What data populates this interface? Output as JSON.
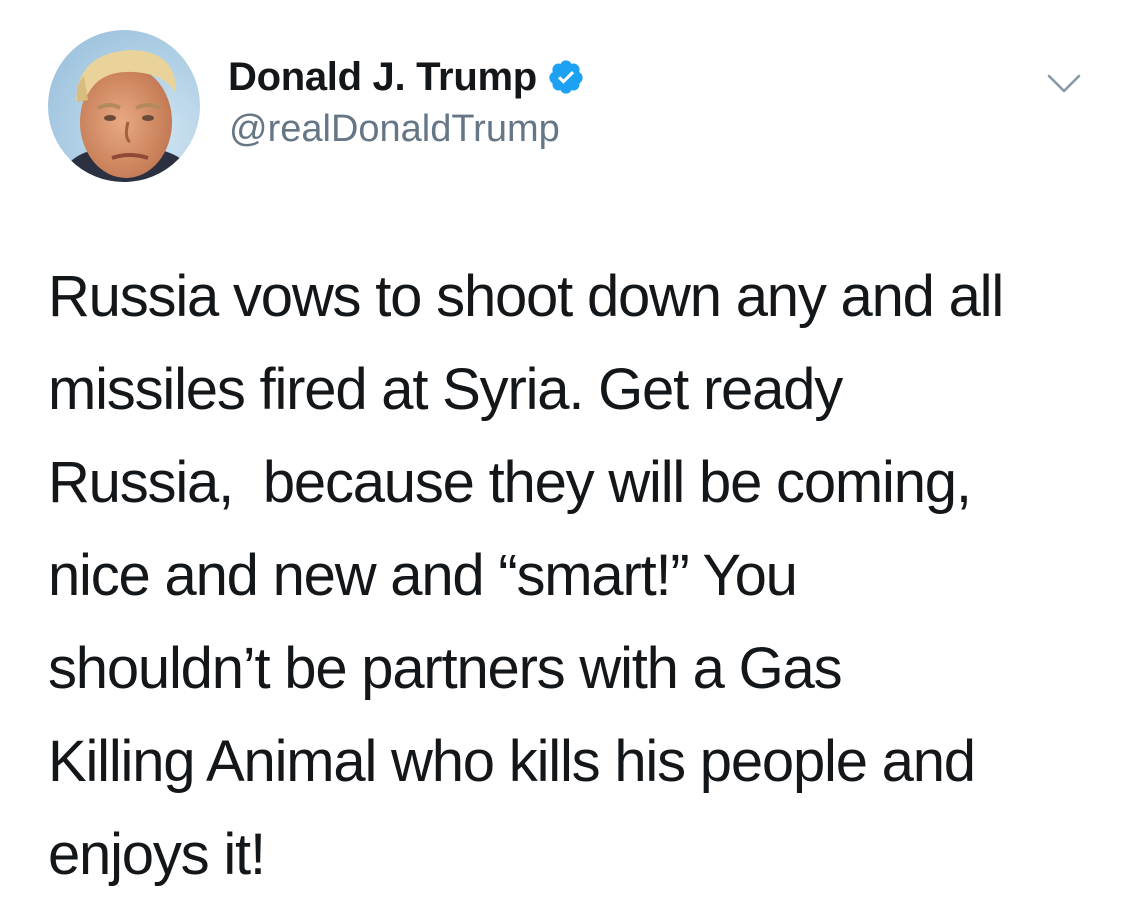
{
  "tweet": {
    "author": {
      "display_name": "Donald J. Trump",
      "handle": "@realDonaldTrump",
      "verified": true
    },
    "icons": {
      "avatar": "profile-photo",
      "verified": "verified-badge-icon",
      "menu": "chevron-down-icon"
    },
    "colors": {
      "verified_badge": "#1da1f2",
      "handle": "#657786",
      "text": "#14171a",
      "caret": "#8899a6"
    },
    "text_lines": [
      "Russia vows to shoot down any and all",
      "missiles fired at Syria. Get ready",
      "Russia,  because they will be coming,",
      "nice and new and “smart!” You",
      "shouldn’t be partners with a Gas",
      "Killing Animal who kills his people and",
      "enjoys it!"
    ]
  }
}
